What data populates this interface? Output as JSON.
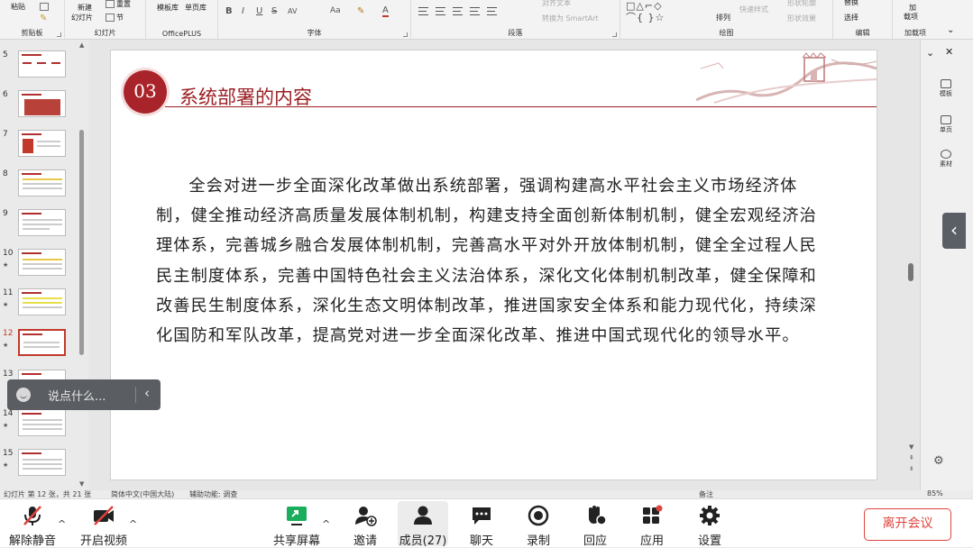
{
  "ribbon": {
    "paste": "粘贴",
    "new_slide": "新建",
    "new_slide2": "幻灯片",
    "reset": "重置",
    "section": "节",
    "template_lib": "模板库",
    "single_page_lib": "单页库",
    "format_buttons": [
      "B",
      "I",
      "U",
      "S",
      "AV",
      "Aa"
    ],
    "align_text": "对齐文本",
    "smartart": "转换为 SmartArt",
    "arrange": "排列",
    "quick_styles": "快速样式",
    "shape_outline": "形状轮廓",
    "shape_effects": "形状效果",
    "replace": "替换",
    "select": "选择",
    "add": "加",
    "add2": "载项",
    "groups": [
      "剪贴板",
      "幻灯片",
      "OfficePLUS",
      "字体",
      "段落",
      "绘图",
      "编辑",
      "加载项"
    ]
  },
  "thumbnails": [
    {
      "num": "5",
      "star": ""
    },
    {
      "num": "6",
      "star": ""
    },
    {
      "num": "7",
      "star": ""
    },
    {
      "num": "8",
      "star": ""
    },
    {
      "num": "9",
      "star": ""
    },
    {
      "num": "10",
      "star": "★"
    },
    {
      "num": "11",
      "star": "★"
    },
    {
      "num": "12",
      "star": "★"
    },
    {
      "num": "13",
      "star": ""
    },
    {
      "num": "14",
      "star": "★"
    },
    {
      "num": "15",
      "star": "★"
    }
  ],
  "slide": {
    "badge": "03",
    "title": "系统部署的内容",
    "body": "全会对进一步全面深化改革做出系统部署，强调构建高水平社会主义市场经济体制，健全推动经济高质量发展体制机制，构建支持全面创新体制机制，健全宏观经济治理体系，完善城乡融合发展体制机制，完善高水平对外开放体制机制，健全全过程人民民主制度体系，完善中国特色社会主义法治体系，深化文化体制机制改革，健全保障和改善民生制度体系，深化生态文明体制改革，推进国家安全体系和能力现代化，持续深化国防和军队改革，提高党对进一步全面深化改革、推进中国式现代化的领导水平。"
  },
  "side_pane": {
    "template": "模板",
    "single_page": "单页",
    "material": "素材"
  },
  "status": {
    "slide_info": "幻灯片 第 12 张，共 21 张",
    "language": "简体中文(中国大陆)",
    "accessibility": "辅助功能: 调查",
    "notes": "备注",
    "zoom": "85%"
  },
  "say_pill": {
    "placeholder": "说点什么..."
  },
  "toolbar": {
    "unmute": "解除静音",
    "start_video": "开启视频",
    "share_screen": "共享屏幕",
    "invite": "邀请",
    "members": "成员(27)",
    "chat": "聊天",
    "record": "录制",
    "reactions": "回应",
    "apps": "应用",
    "settings": "设置",
    "leave": "离开会议"
  },
  "colors": {
    "accent_red": "#a9242a",
    "leave_red": "#e0443e",
    "share_green": "#1aad5b"
  }
}
